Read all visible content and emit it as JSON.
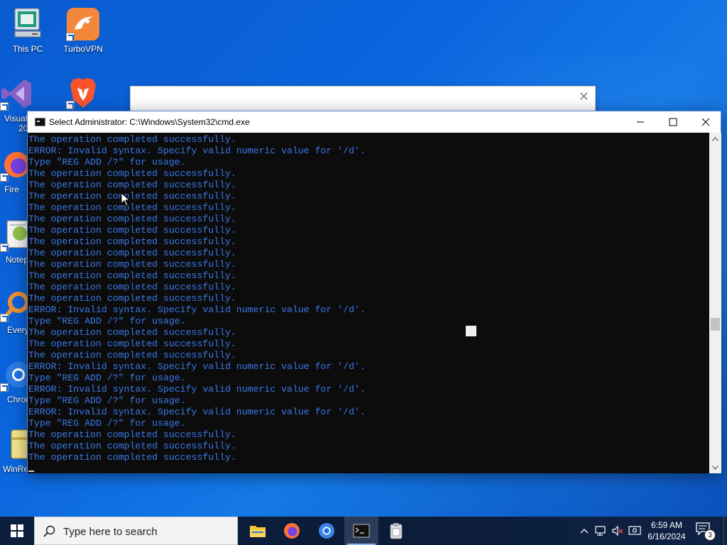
{
  "desktop": {
    "icons": [
      {
        "label": "This PC",
        "icon": "this-pc-icon"
      },
      {
        "label": "TurboVPN",
        "icon": "turbovpn-icon"
      },
      {
        "label": "Visual",
        "icon": "visual-studio-icon"
      },
      {
        "label": "",
        "icon": "brave-icon"
      },
      {
        "label": "Fire",
        "icon": "firefox-icon"
      },
      {
        "label": "Notep",
        "icon": "notepad-icon"
      },
      {
        "label": "Every",
        "icon": "everything-icon"
      },
      {
        "label": "Chron",
        "icon": "chrome-icon"
      },
      {
        "label": "WinRe",
        "icon": "winrar-icon"
      }
    ],
    "partial_label_2": "20"
  },
  "cmd_window": {
    "title": "Select Administrator: C:\\Windows\\System32\\cmd.exe",
    "lines": [
      "The operation completed successfully.",
      "ERROR: Invalid syntax. Specify valid numeric value for '/d'.",
      "Type \"REG ADD /?\" for usage.",
      "The operation completed successfully.",
      "The operation completed successfully.",
      "The operation completed successfully.",
      "The operation completed successfully.",
      "The operation completed successfully.",
      "The operation completed successfully.",
      "The operation completed successfully.",
      "The operation completed successfully.",
      "The operation completed successfully.",
      "The operation completed successfully.",
      "The operation completed successfully.",
      "The operation completed successfully.",
      "ERROR: Invalid syntax. Specify valid numeric value for '/d'.",
      "Type \"REG ADD /?\" for usage.",
      "The operation completed successfully.",
      "The operation completed successfully.",
      "The operation completed successfully.",
      "ERROR: Invalid syntax. Specify valid numeric value for '/d'.",
      "Type \"REG ADD /?\" for usage.",
      "ERROR: Invalid syntax. Specify valid numeric value for '/d'.",
      "Type \"REG ADD /?\" for usage.",
      "ERROR: Invalid syntax. Specify valid numeric value for '/d'.",
      "Type \"REG ADD /?\" for usage.",
      "The operation completed successfully.",
      "The operation completed successfully.",
      "The operation completed successfully."
    ],
    "text_color": "#3a78e8",
    "background": "#0c0c0c"
  },
  "taskbar": {
    "search_placeholder": "Type here to search",
    "apps": [
      "file-explorer-icon",
      "firefox-icon",
      "chrome-icon",
      "cmd-icon",
      "clipboard-app-icon"
    ],
    "time": "6:59 AM",
    "date": "6/16/2024",
    "notification_count": "3"
  }
}
